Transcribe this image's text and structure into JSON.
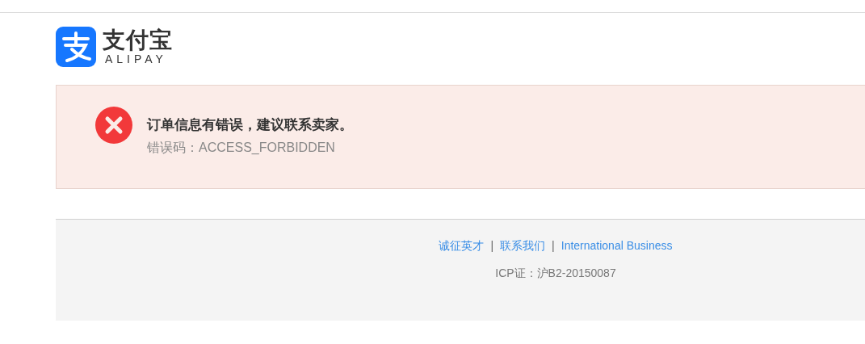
{
  "logo": {
    "name": "支付宝",
    "subtitle": "ALIPAY"
  },
  "error": {
    "message": "订单信息有错误，建议联系卖家。",
    "code": "错误码：ACCESS_FORBIDDEN"
  },
  "footer": {
    "links": [
      {
        "label": "诚征英才"
      },
      {
        "label": "联系我们"
      },
      {
        "label": "International Business"
      }
    ],
    "separator": "|",
    "license": "ICP证：沪B2-20150087"
  }
}
